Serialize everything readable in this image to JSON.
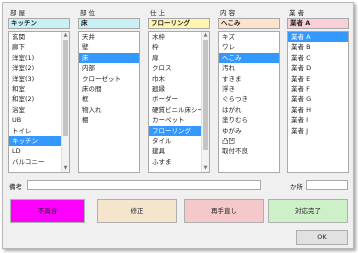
{
  "columns": [
    {
      "title": "部 屋",
      "field_value": "キッチン",
      "field_color": "#c8f0f5",
      "items": [
        "玄関",
        "廊下",
        "洋室(1)",
        "洋室(2)",
        "洋室(3)",
        "和室",
        "和室(2)",
        "浴室",
        "UB",
        "トイレ",
        "キッチン",
        "LD",
        "バルコニー"
      ],
      "selected_index": 10
    },
    {
      "title": "部 位",
      "field_value": "床",
      "field_color": "#c8f0f5",
      "items": [
        "天井",
        "壁",
        "床",
        "内部",
        "クローゼット",
        "床の間",
        "框",
        "物入れ",
        "棚"
      ],
      "selected_index": 2
    },
    {
      "title": "仕 上",
      "field_value": "フローリング",
      "field_color": "#fff5b0",
      "items": [
        "木枠",
        "枠",
        "扉",
        "クロス",
        "巾木",
        "廻縁",
        "ボーダー",
        "硬質ビニル床シート",
        "カーペット",
        "フローリング",
        "タイル",
        "建具",
        "ふすま"
      ],
      "selected_index": 9
    },
    {
      "title": "内 容",
      "field_value": "へこみ",
      "field_color": "#fde3cc",
      "items": [
        "キズ",
        "ワレ",
        "へこみ",
        "汚れ",
        "すきま",
        "浮き",
        "ぐらつき",
        "はがれ",
        "塗りむら",
        "ゆがみ",
        "凸凹",
        "取付不良"
      ],
      "selected_index": 2
    },
    {
      "title": "業 者",
      "field_value": "業者 A",
      "field_color": "#f9d0d6",
      "items": [
        "業者 A",
        "業者 B",
        "業者 C",
        "業者 D",
        "業者 E",
        "業者 F",
        "業者 G",
        "業者 H",
        "業者 I",
        "業者 J"
      ],
      "selected_index": 0
    }
  ],
  "remarks": {
    "label": "備考",
    "value": ""
  },
  "places": {
    "label": "か所",
    "value": ""
  },
  "buttons": [
    {
      "label": "不具合",
      "color": "#ff00ff"
    },
    {
      "label": "修正",
      "color": "#f5e5cc"
    },
    {
      "label": "再手直し",
      "color": "#f5c9c9"
    },
    {
      "label": "対応完了",
      "color": "#cdf0c8"
    }
  ],
  "ok_button": {
    "label": "OK"
  },
  "colors": {
    "selection": "#3399ff",
    "window_bg": "#f0f0f0"
  }
}
